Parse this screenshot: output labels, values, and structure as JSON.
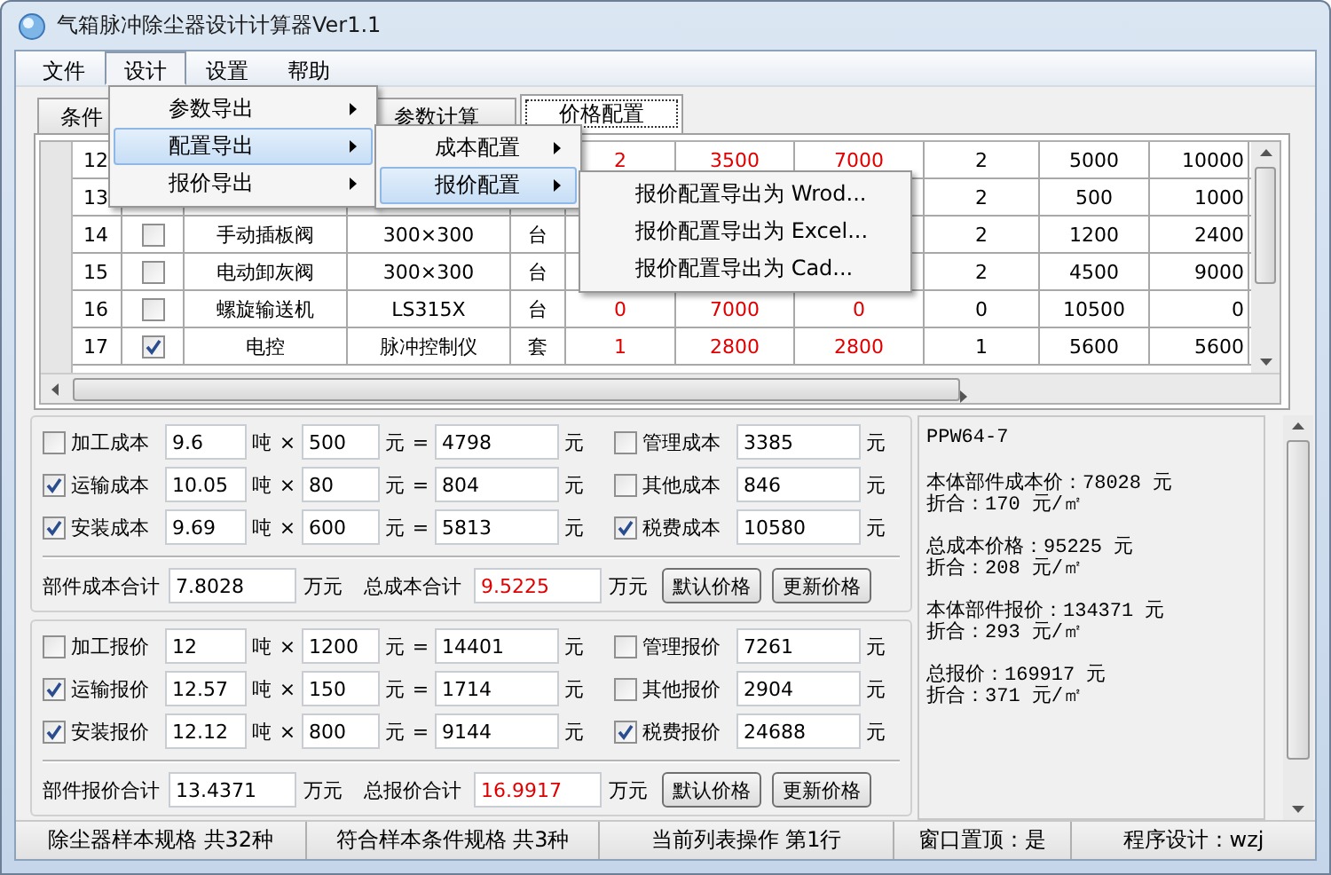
{
  "window": {
    "title": "气箱脉冲除尘器设计计算器Ver1.1"
  },
  "menu_bar": [
    {
      "label": "文件",
      "selected": false
    },
    {
      "label": "设计",
      "selected": true
    },
    {
      "label": "设置",
      "selected": false
    },
    {
      "label": "帮助",
      "selected": false
    }
  ],
  "tabs": [
    {
      "label": "条件",
      "selected": false
    },
    {
      "label": "参数计算",
      "selected": false
    },
    {
      "label": "价格配置",
      "selected": true
    }
  ],
  "table": {
    "rows": [
      {
        "no": "12",
        "column_6": "2",
        "column_7": "3500",
        "column_8": "7000",
        "column_9": "2",
        "column_10": "5000",
        "column_11": "10000"
      },
      {
        "no": "13",
        "column_9": "2",
        "column_10": "500",
        "column_11": "1000"
      },
      {
        "no": "14",
        "checked": false,
        "name": "手动插板阀",
        "spec": "300×300",
        "unit": "台",
        "column_9": "2",
        "column_10": "1200",
        "column_11": "2400"
      },
      {
        "no": "15",
        "checked": false,
        "name": "电动卸灰阀",
        "spec": "300×300",
        "unit": "台",
        "column_9": "2",
        "column_10": "4500",
        "column_11": "9000"
      },
      {
        "no": "16",
        "checked": false,
        "name": "螺旋输送机",
        "spec": "LS315X",
        "unit": "台",
        "column_6": "0",
        "column_7": "7000",
        "column_8": "0",
        "column_9": "0",
        "column_10": "10500",
        "column_11": "0"
      },
      {
        "no": "17",
        "checked": true,
        "name": "电控",
        "spec": "脉冲控制仪",
        "unit": "套",
        "column_6": "1",
        "column_7": "2800",
        "column_8": "2800",
        "column_9": "1",
        "column_10": "5600",
        "column_11": "5600"
      }
    ]
  },
  "sections": [
    {
      "rows": [
        {
          "checked": false,
          "label": "加工成本",
          "tons": "9.6",
          "ton_unit": "吨",
          "times": "×",
          "price": "500",
          "price_unit": "元",
          "equals": "=",
          "amount": "4798",
          "amount_unit": "元",
          "extra": {
            "checked": false,
            "label": "管理成本",
            "value": "3385",
            "unit": "元"
          }
        },
        {
          "checked": true,
          "label": "运输成本",
          "tons": "10.05",
          "ton_unit": "吨",
          "times": "×",
          "price": "80",
          "price_unit": "元",
          "equals": "=",
          "amount": "804",
          "amount_unit": "元",
          "extra": {
            "checked": false,
            "label": "其他成本",
            "value": "846",
            "unit": "元"
          }
        },
        {
          "checked": true,
          "label": "安装成本",
          "tons": "9.69",
          "ton_unit": "吨",
          "times": "×",
          "price": "600",
          "price_unit": "元",
          "equals": "=",
          "amount": "5813",
          "amount_unit": "元",
          "extra": {
            "checked": true,
            "label": "税费成本",
            "value": "10580",
            "unit": "元"
          }
        }
      ],
      "summary": {
        "part_label": "部件成本合计",
        "part_value": "7.8028",
        "part_unit": "万元",
        "total_label": "总成本合计",
        "total_value": "9.5225",
        "total_unit": "万元"
      },
      "buttons": [
        "默认价格",
        "更新价格"
      ]
    },
    {
      "rows": [
        {
          "checked": false,
          "label": "加工报价",
          "tons": "12",
          "ton_unit": "吨",
          "times": "×",
          "price": "1200",
          "price_unit": "元",
          "equals": "=",
          "amount": "14401",
          "amount_unit": "元",
          "extra": {
            "checked": false,
            "label": "管理报价",
            "value": "7261",
            "unit": "元"
          }
        },
        {
          "checked": true,
          "label": "运输报价",
          "tons": "12.57",
          "ton_unit": "吨",
          "times": "×",
          "price": "150",
          "price_unit": "元",
          "equals": "=",
          "amount": "1714",
          "amount_unit": "元",
          "extra": {
            "checked": false,
            "label": "其他报价",
            "value": "2904",
            "unit": "元"
          }
        },
        {
          "checked": true,
          "label": "安装报价",
          "tons": "12.12",
          "ton_unit": "吨",
          "times": "×",
          "price": "800",
          "price_unit": "元",
          "equals": "=",
          "amount": "9144",
          "amount_unit": "元",
          "extra": {
            "checked": true,
            "label": "税费报价",
            "value": "24688",
            "unit": "元"
          }
        }
      ],
      "summary": {
        "part_label": "部件报价合计",
        "part_value": "13.4371",
        "part_unit": "万元",
        "total_label": "总报价合计",
        "total_value": "16.9917",
        "total_unit": "万元"
      },
      "buttons": [
        "默认价格",
        "更新价格"
      ]
    }
  ],
  "result_panel": {
    "model": "PPW64-7",
    "blocks": [
      {
        "price": "本体部件成本价：78028 元",
        "rate": "折合：170 元/㎡"
      },
      {
        "price": "总成本价格：95225 元",
        "rate": "折合：208 元/㎡"
      },
      {
        "price": "本体部件报价：134371 元",
        "rate": "折合：293 元/㎡"
      },
      {
        "price": "总报价：169917 元",
        "rate": "折合：371 元/㎡"
      }
    ]
  },
  "menus": [
    {
      "items": [
        {
          "label": "参数导出",
          "submenu": true,
          "selected": false
        },
        {
          "label": "配置导出",
          "submenu": true,
          "selected": true
        },
        {
          "label": "报价导出",
          "submenu": true,
          "selected": false
        }
      ]
    },
    {
      "items": [
        {
          "label": "成本配置",
          "submenu": true,
          "selected": false
        },
        {
          "label": "报价配置",
          "submenu": true,
          "selected": true
        }
      ]
    },
    {
      "items": [
        {
          "label": "报价配置导出为 Wrod...",
          "submenu": false,
          "selected": false
        },
        {
          "label": "报价配置导出为 Excel...",
          "submenu": false,
          "selected": false
        },
        {
          "label": "报价配置导出为 Cad...",
          "submenu": false,
          "selected": false
        }
      ]
    }
  ],
  "status_bar": [
    "除尘器样本规格 共32种",
    "符合样本条件规格 共3种",
    "当前列表操作 第1行",
    "窗口置顶：是",
    "程序设计：wzj"
  ]
}
